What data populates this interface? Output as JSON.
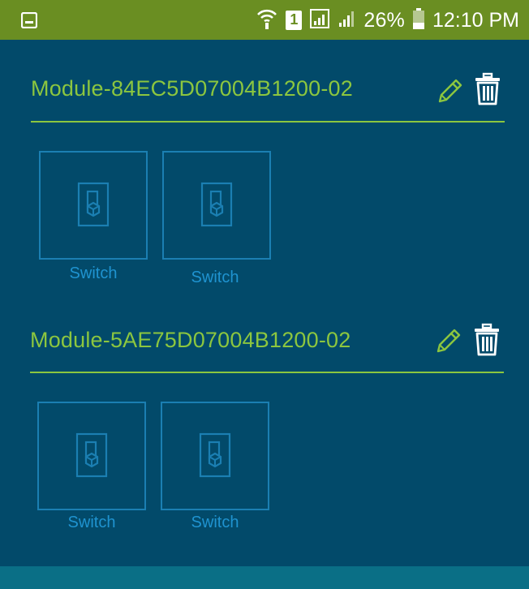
{
  "status_bar": {
    "battery": "26%",
    "time": "12:10 PM",
    "sim_slot": "1"
  },
  "modules": [
    {
      "title": "Module-84EC5D07004B1200-02",
      "devices": [
        {
          "label": "Switch"
        },
        {
          "label": "Switch"
        }
      ]
    },
    {
      "title": "Module-5AE75D07004B1200-02",
      "devices": [
        {
          "label": "Switch"
        },
        {
          "label": "Switch"
        }
      ]
    }
  ],
  "colors": {
    "status_bar": "#6a8e22",
    "background": "#024a6a",
    "accent_green": "#8cc63f",
    "accent_blue": "#1f93d0"
  }
}
